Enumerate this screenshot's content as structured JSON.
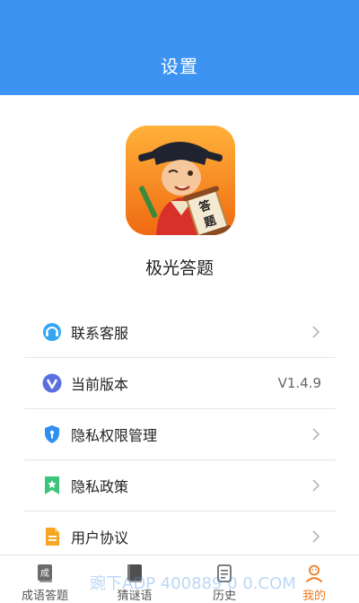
{
  "header": {
    "title": "设置"
  },
  "app": {
    "name": "极光答题",
    "icon_badge_text": "答题"
  },
  "menu": [
    {
      "label": "联系客服",
      "icon": "customer-service-icon",
      "has_chevron": true
    },
    {
      "label": "当前版本",
      "icon": "version-icon",
      "value": "V1.4.9"
    },
    {
      "label": "隐私权限管理",
      "icon": "privacy-shield-icon",
      "has_chevron": true
    },
    {
      "label": "隐私政策",
      "icon": "bookmark-star-icon",
      "has_chevron": true
    },
    {
      "label": "用户协议",
      "icon": "document-icon",
      "has_chevron": true
    }
  ],
  "tabs": [
    {
      "label": "成语答题",
      "icon": "idiom-book-icon",
      "icon_text": "成",
      "active": false
    },
    {
      "label": "猜谜语",
      "icon": "riddle-book-icon",
      "active": false
    },
    {
      "label": "历史",
      "icon": "history-list-icon",
      "active": false
    },
    {
      "label": "我的",
      "icon": "profile-icon",
      "active": true
    }
  ],
  "watermark": {
    "text": "豌下ADP 400889 0 0.COM"
  },
  "colors": {
    "header_bg": "#3d93f2",
    "active_tab": "#f07a1e",
    "divider": "#e6e6e6"
  }
}
